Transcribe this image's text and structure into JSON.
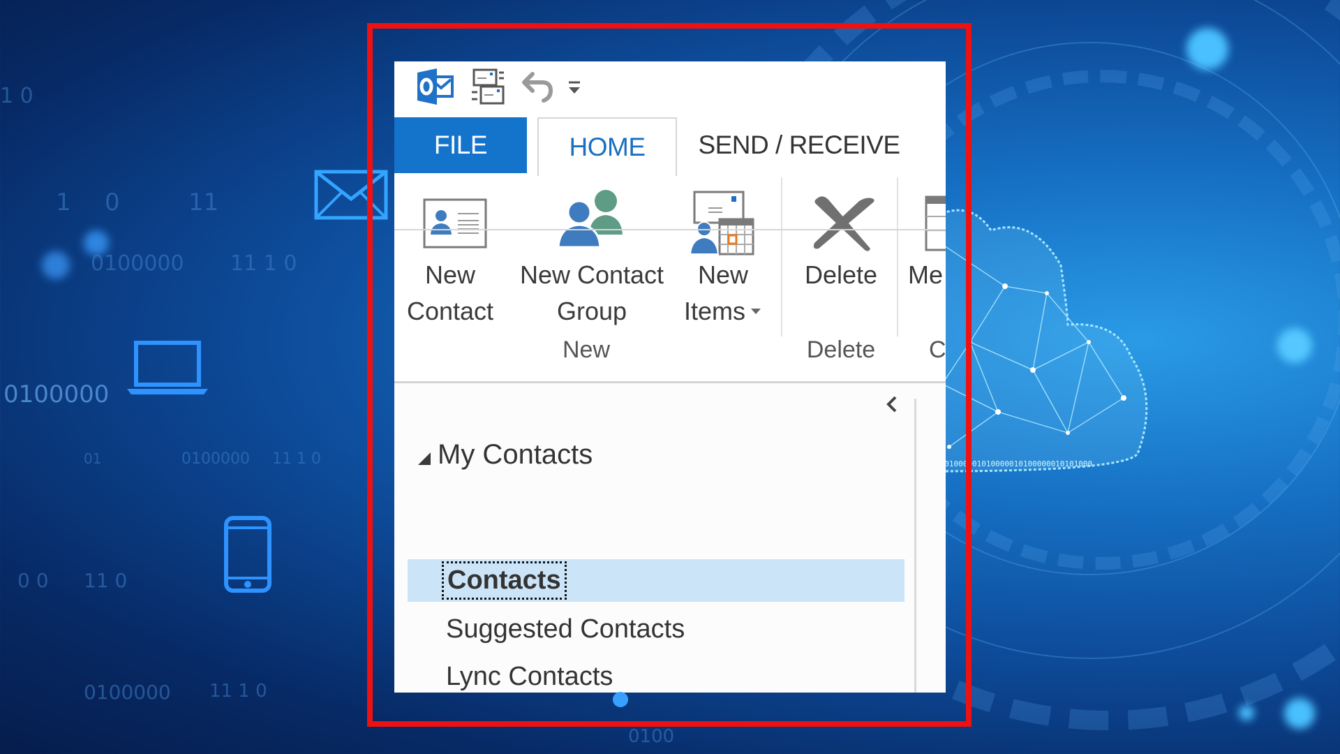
{
  "background": {
    "binary_strings": [
      "0100000",
      "11",
      "1",
      "0",
      "0100000",
      "11 1 0",
      "01",
      "0100000",
      "11 1 0",
      "1 0",
      "0 0",
      "11 0",
      "0100000",
      "11 1 0",
      "01",
      "0100",
      "0100000 11 1 0",
      "1 0",
      "00 11 0",
      "01"
    ],
    "cloud_binary": "0101000001010000010100000010101000"
  },
  "window": {
    "quick_access": {
      "app_icon": "outlook-icon",
      "items": [
        {
          "name": "send-receive-all-folders",
          "icon": "send-receive-icon"
        },
        {
          "name": "undo",
          "icon": "undo-icon"
        },
        {
          "name": "customize-quick-access",
          "icon": "customize-dropdown-icon"
        }
      ]
    },
    "tabs": [
      {
        "label": "FILE",
        "active": false
      },
      {
        "label": "HOME",
        "active": true
      },
      {
        "label": "SEND / RECEIVE",
        "active": false
      }
    ],
    "ribbon": {
      "groups": [
        {
          "label": "New",
          "buttons": [
            {
              "label_line1": "New",
              "label_line2": "Contact",
              "icon": "new-contact-icon"
            },
            {
              "label_line1": "New Contact",
              "label_line2": "Group",
              "icon": "new-contact-group-icon"
            },
            {
              "label_line1": "New",
              "label_line2": "Items",
              "icon": "new-items-icon",
              "dropdown": true
            }
          ]
        },
        {
          "label": "Delete",
          "buttons": [
            {
              "label_line1": "Delete",
              "icon": "delete-icon"
            }
          ]
        },
        {
          "label": "C",
          "buttons": [
            {
              "label_line1": "Me",
              "icon": "meeting-icon"
            }
          ]
        }
      ]
    },
    "nav_pane": {
      "collapse_label": "‹",
      "section": "My Contacts",
      "folders": [
        {
          "label": "Contacts",
          "selected": true
        },
        {
          "label": "Suggested Contacts",
          "selected": false
        },
        {
          "label": "Lync Contacts",
          "selected": false
        }
      ]
    }
  },
  "colors": {
    "file_tab": "#1474cc",
    "home_tab_text": "#1a6fc0",
    "selected_folder_bg": "#cce4f7",
    "highlight_frame": "#ee1111",
    "person_blue": "#3f7bbf",
    "person_green": "#5e9c86"
  }
}
